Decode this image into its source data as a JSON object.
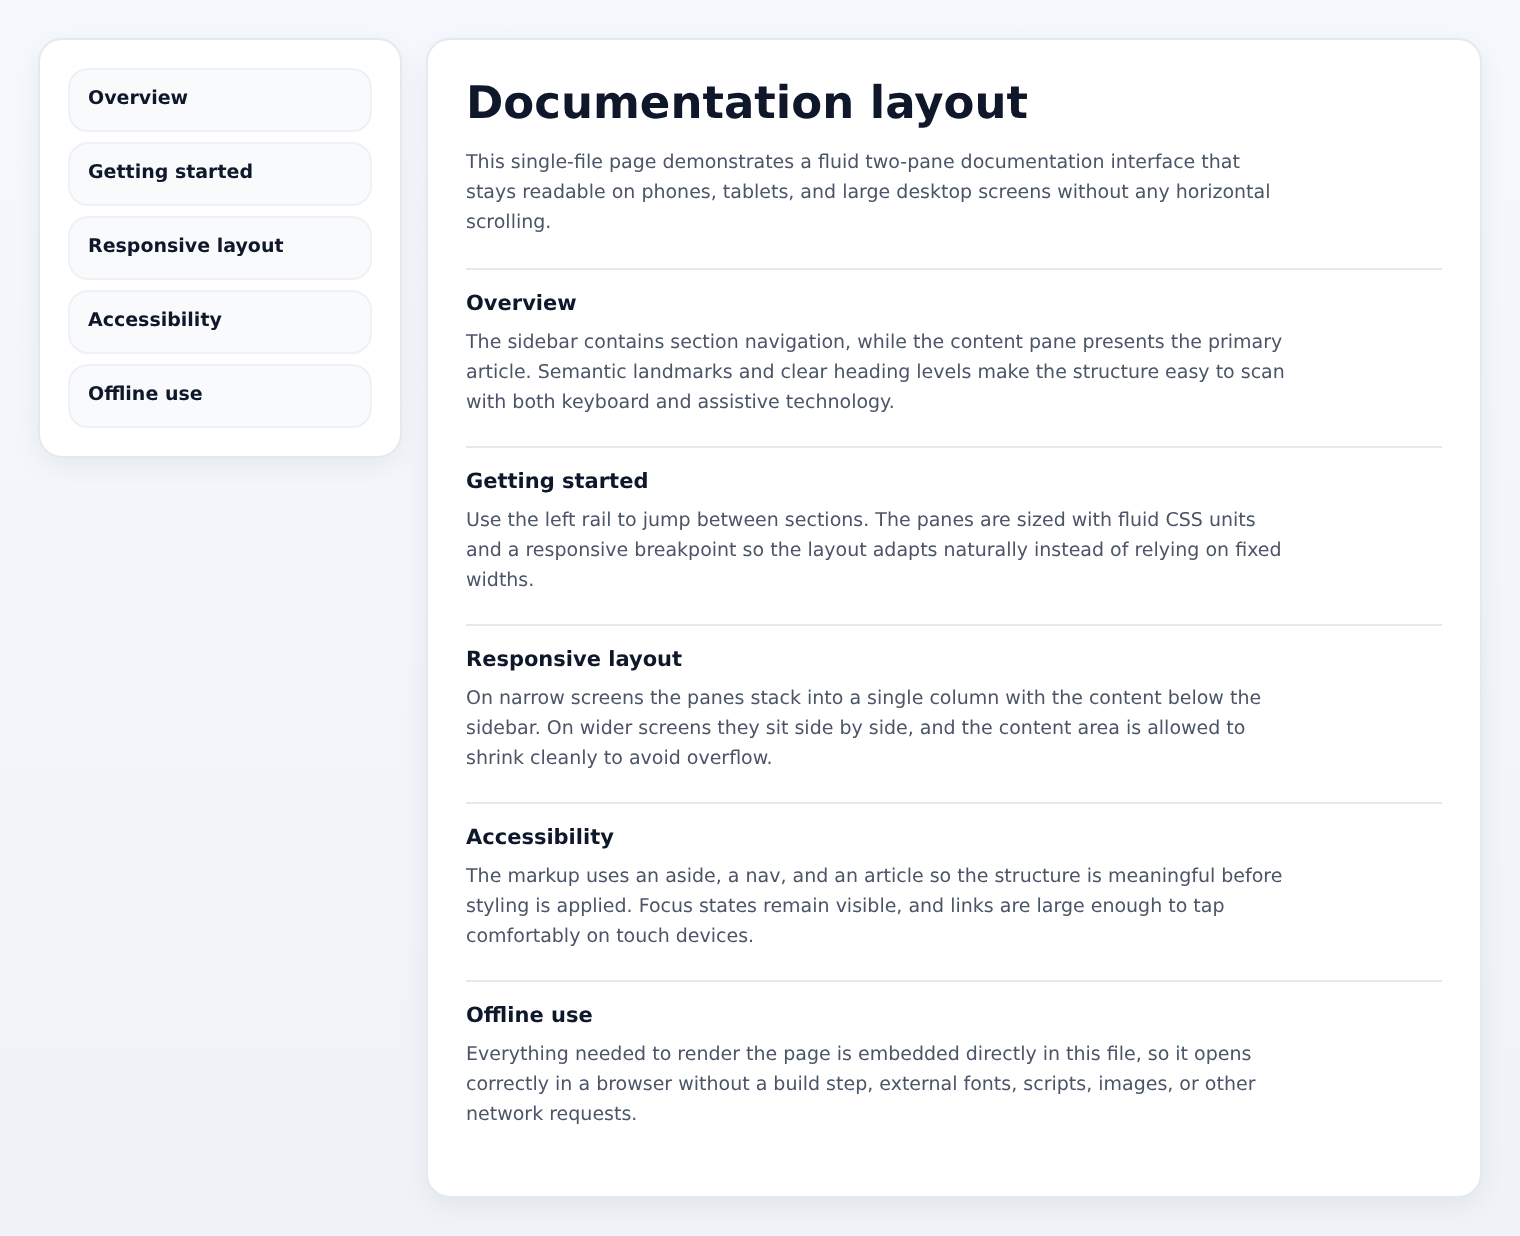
{
  "sidebar": {
    "items": [
      {
        "label": "Overview",
        "selected": false
      },
      {
        "label": "Getting started",
        "selected": false
      },
      {
        "label": "Responsive layout",
        "selected": false
      },
      {
        "label": "Accessibility",
        "selected": false
      },
      {
        "label": "Offline use",
        "selected": false
      }
    ]
  },
  "article": {
    "title": "Documentation layout",
    "intro": "This single-file page demonstrates a fluid two-pane documentation interface that stays readable on phones, tablets, and large desktop screens without any horizontal scrolling.",
    "sections": [
      {
        "heading": "Overview",
        "body": "The sidebar contains section navigation, while the content pane presents the primary article. Semantic landmarks and clear heading levels make the structure easy to scan with both keyboard and assistive technology."
      },
      {
        "heading": "Getting started",
        "body": "Use the left rail to jump between sections. The panes are sized with fluid CSS units and a responsive breakpoint so the layout adapts naturally instead of relying on fixed widths."
      },
      {
        "heading": "Responsive layout",
        "body": "On narrow screens the panes stack into a single column with the content below the sidebar. On wider screens they sit side by side, and the content area is allowed to shrink cleanly to avoid overflow."
      },
      {
        "heading": "Accessibility",
        "body": "The markup uses an aside, a nav, and an article so the structure is meaningful before styling is applied. Focus states remain visible, and links are large enough to tap comfortably on touch devices."
      },
      {
        "heading": "Offline use",
        "body": "Everything needed to render the page is embedded directly in this file, so it opens correctly in a browser without a build step, external fonts, scripts, images, or other network requests."
      }
    ]
  }
}
